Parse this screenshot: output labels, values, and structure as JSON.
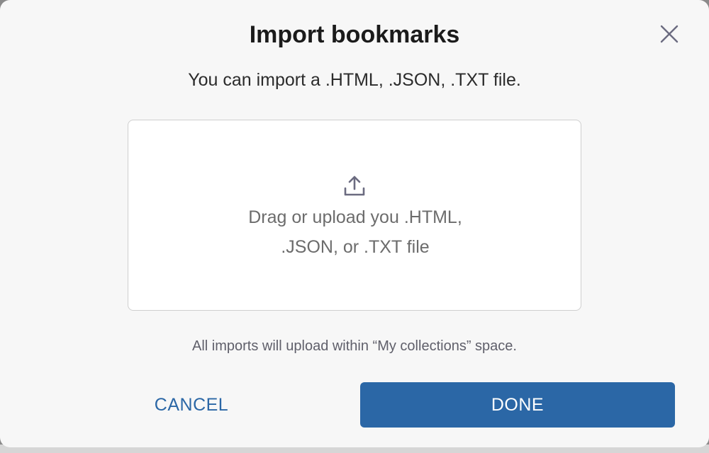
{
  "dialog": {
    "title": "Import bookmarks",
    "subtitle": "You can import a .HTML, .JSON, .TXT file.",
    "close_icon": "close-icon",
    "dropzone": {
      "icon": "upload-icon",
      "line1": "Drag or upload you .HTML,",
      "line2": ".JSON, or .TXT file"
    },
    "note": "All imports will upload within “My collections” space.",
    "cancel_label": "CANCEL",
    "done_label": "DONE"
  },
  "colors": {
    "primary": "#2b67a6",
    "dialog_bg": "#f7f7f7",
    "dropzone_border": "#cfcfcf",
    "icon": "#6b6b80"
  }
}
